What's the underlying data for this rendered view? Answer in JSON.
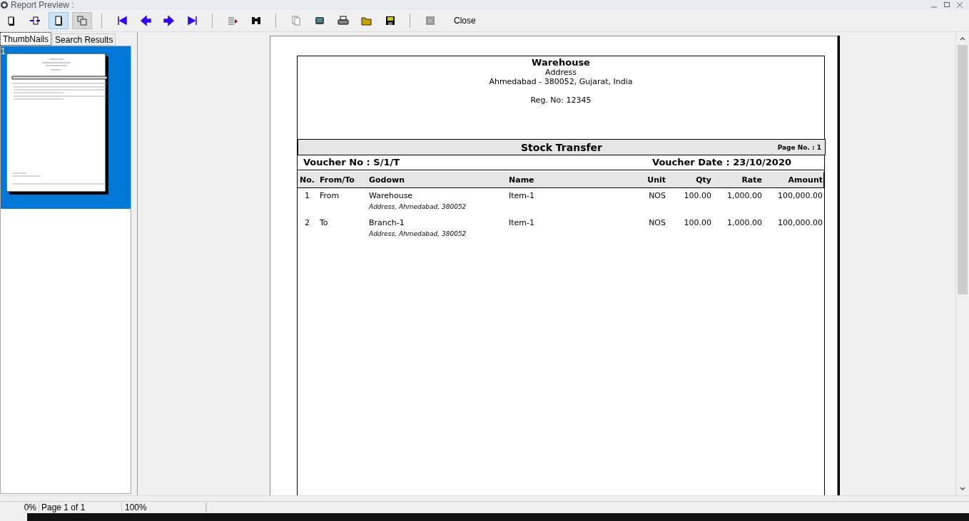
{
  "window": {
    "title": "Report Preview :"
  },
  "toolbar": {
    "view_buttons": [
      {
        "kind": "page",
        "selected": false,
        "pressed": false
      },
      {
        "kind": "fit-width",
        "selected": false,
        "pressed": false
      },
      {
        "kind": "single-page",
        "selected": true,
        "pressed": false
      },
      {
        "kind": "multi-page",
        "selected": false,
        "pressed": true
      }
    ],
    "nav_buttons": [
      {
        "kind": "first"
      },
      {
        "kind": "prev"
      },
      {
        "kind": "next"
      },
      {
        "kind": "last"
      }
    ],
    "tool_buttons": [
      {
        "kind": "goto"
      },
      {
        "kind": "find"
      },
      {
        "kind": "copy"
      },
      {
        "kind": "export"
      },
      {
        "kind": "print"
      },
      {
        "kind": "open"
      },
      {
        "kind": "save"
      },
      {
        "kind": "stop"
      }
    ],
    "close_label": "Close"
  },
  "tabs": [
    {
      "label": "ThumbNails",
      "selected": true
    },
    {
      "label": "Search Results",
      "selected": false
    }
  ],
  "thumbnails": [
    {
      "number": "1",
      "selected": true
    }
  ],
  "report": {
    "company": "Warehouse",
    "address_lines": [
      "Address",
      "Ahmedabad - 380052, Gujarat, India"
    ],
    "reg_no": "Reg. No: 12345",
    "title": "Stock Transfer",
    "page_no": "Page No. : 1",
    "voucher_no": "Voucher No : S/1/T",
    "voucher_date": "Voucher Date : 23/10/2020",
    "columns": [
      "No.",
      "From/To",
      "Godown",
      "Name",
      "Unit",
      "Qty",
      "Rate",
      "Amount"
    ],
    "rows": [
      {
        "no": "1",
        "from_to": "From",
        "godown": "Warehouse",
        "godown_address": "Address, Ahmedabad, 380052",
        "name": "Item-1",
        "unit": "NOS",
        "qty": "100.00",
        "rate": "1,000.00",
        "amount": "100,000.00"
      },
      {
        "no": "2",
        "from_to": "To",
        "godown": "Branch-1",
        "godown_address": "Address, Ahmedabad, 380052",
        "name": "Item-1",
        "unit": "NOS",
        "qty": "100.00",
        "rate": "1,000.00",
        "amount": "100,000.00"
      }
    ]
  },
  "status_bar": {
    "progress": "0%",
    "page": "Page 1 of 1",
    "zoom": "100%"
  }
}
